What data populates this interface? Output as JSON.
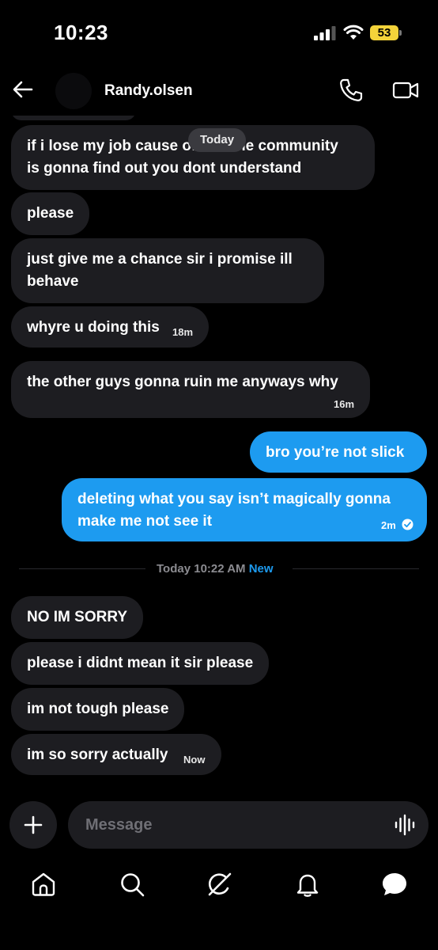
{
  "status_bar": {
    "time": "10:23",
    "battery": "53"
  },
  "header": {
    "contact_name": "Randy.olsen"
  },
  "chat": {
    "date_pill": "Today",
    "messages": [
      {
        "text": "if i lose my job cause of this the community",
        "text2": "is gonna find out you dont understand"
      },
      {
        "text": "please"
      },
      {
        "text": "just give me a chance sir i promise ill",
        "text2": "behave"
      },
      {
        "text": "whyre u doing this",
        "time": "18m"
      },
      {
        "text": "the other guys gonna ruin me anyways why",
        "time": "16m"
      },
      {
        "text": "bro you’re not slick"
      },
      {
        "text": "deleting what you say isn’t magically gonna",
        "text2": "make me not see it",
        "time": "2m"
      },
      {
        "text": "NO IM SORRY"
      },
      {
        "text": "please i didnt mean it sir please"
      },
      {
        "text": "im not tough please"
      },
      {
        "text": "im so sorry actually",
        "time": "Now"
      }
    ],
    "divider": {
      "label": "Today 10:22 AM",
      "new_label": "New"
    }
  },
  "composer": {
    "placeholder": "Message"
  },
  "icons": {
    "back": "arrow-left-icon",
    "call": "phone-icon",
    "video": "video-camera-icon",
    "add": "plus-icon",
    "voice": "audio-wave-icon",
    "nav": [
      "home-icon",
      "search-icon",
      "grok-icon",
      "bell-icon",
      "messages-icon"
    ]
  },
  "colors": {
    "accent": "#1d9bf0",
    "bubble_in": "#1d1d21",
    "background": "#000000"
  }
}
